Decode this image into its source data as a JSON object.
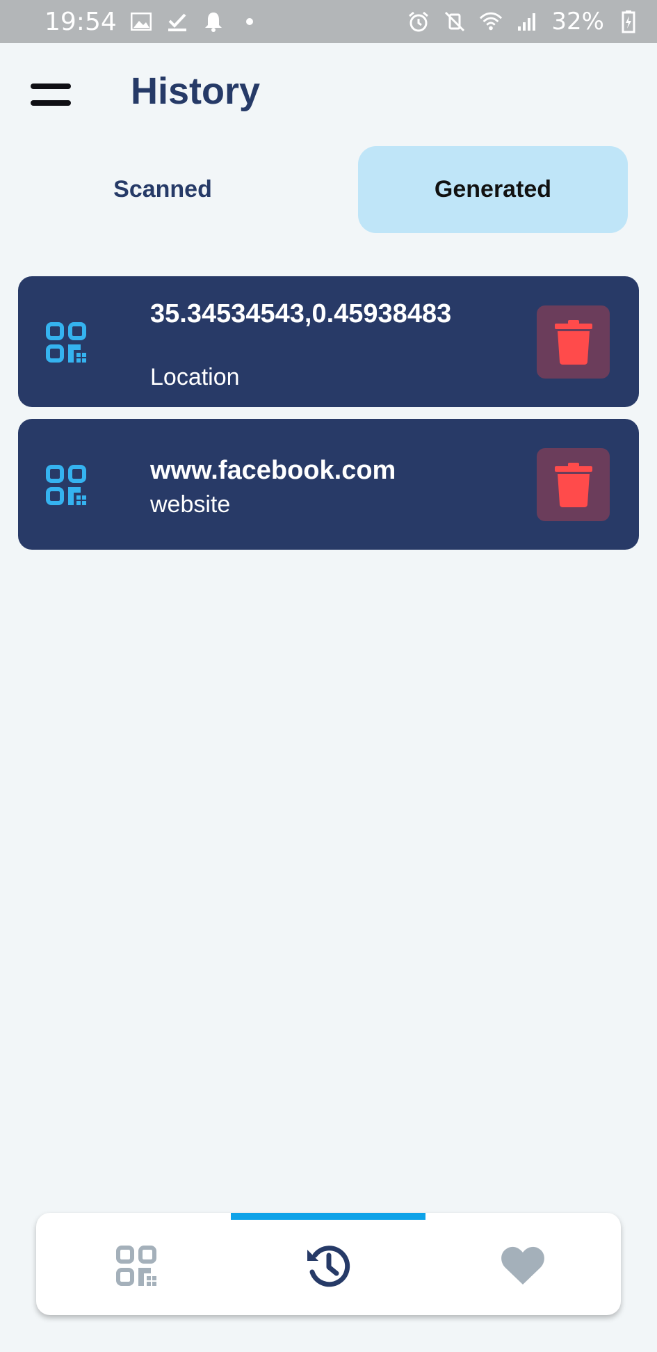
{
  "status_bar": {
    "time": "19:54",
    "battery": "32%"
  },
  "header": {
    "title": "History"
  },
  "tabs": [
    {
      "label": "Scanned",
      "selected": false
    },
    {
      "label": "Generated",
      "selected": true
    }
  ],
  "history_items": [
    {
      "title": "35.34534543,0.45938483",
      "subtitle": "Location"
    },
    {
      "title": "www.facebook.com",
      "subtitle": "website"
    }
  ],
  "bottom_nav": {
    "items": [
      "qr-code-icon",
      "history-icon",
      "heart-icon"
    ],
    "active": "history-icon"
  },
  "colors": {
    "accent": "#0ea2e8",
    "card": "#283a67",
    "delete": "#ff4b4b",
    "qr_icon": "#35b3f0",
    "tab_selected_bg": "#bfe5f8",
    "title": "#263a67"
  }
}
